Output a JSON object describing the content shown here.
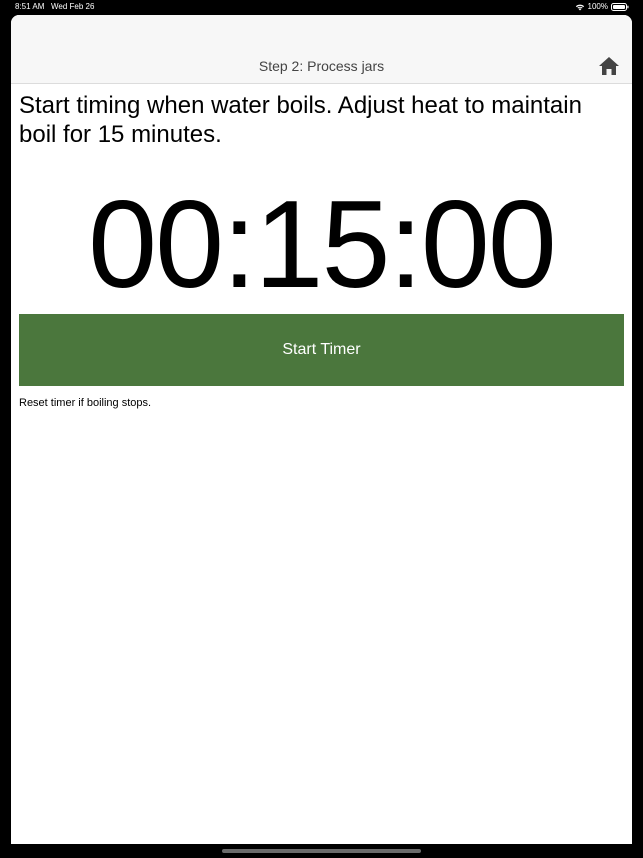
{
  "status_bar": {
    "time": "8:51 AM",
    "date": "Wed Feb 26",
    "battery": "100%"
  },
  "nav": {
    "title": "Step 2: Process jars",
    "home_icon": "home-icon"
  },
  "content": {
    "instruction": "Start timing when water boils. Adjust heat to maintain boil for 15 minutes.",
    "timer": "00:15:00",
    "start_button_label": "Start Timer",
    "hint": "Reset timer if boiling stops."
  },
  "colors": {
    "button": "#4b773d",
    "nav_background": "#f7f7f7"
  }
}
